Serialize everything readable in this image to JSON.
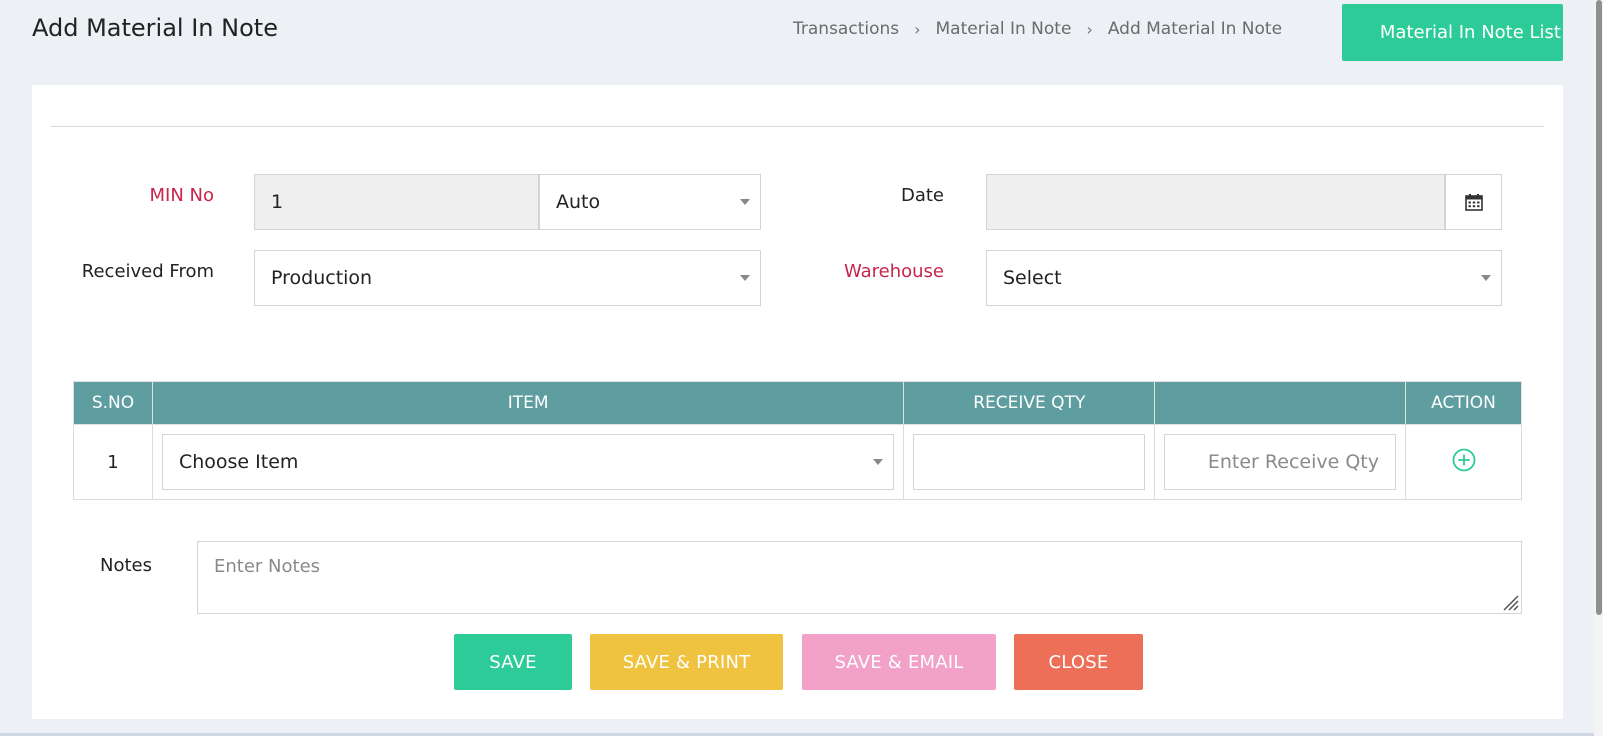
{
  "page": {
    "title": "Add Material In Note",
    "breadcrumb": [
      "Transactions",
      "Material In Note",
      "Add Material In Note"
    ],
    "list_button": "Material In Note List"
  },
  "form": {
    "min_no": {
      "label": "MIN No",
      "value": "1",
      "mode": "Auto"
    },
    "date": {
      "label": "Date",
      "value": ""
    },
    "received_from": {
      "label": "Received From",
      "value": "Production"
    },
    "warehouse": {
      "label": "Warehouse",
      "value": "Select"
    }
  },
  "table": {
    "headers": [
      "S.NO",
      "ITEM",
      "RECEIVE QTY",
      "",
      "ACTION"
    ],
    "rows": [
      {
        "sno": "1",
        "item": "Choose Item",
        "qty": "",
        "receive_placeholder": "Enter Receive Qty"
      }
    ]
  },
  "notes": {
    "label": "Notes",
    "placeholder": "Enter Notes"
  },
  "buttons": {
    "save": "SAVE",
    "save_print": "SAVE & PRINT",
    "save_email": "SAVE & EMAIL",
    "close": "CLOSE"
  },
  "colors": {
    "primary": "#2dcb98",
    "table_header": "#5f9ea0",
    "required_label": "#c8244c",
    "save_print": "#efc33f",
    "save_email": "#f2a2c8",
    "close": "#ee6f57"
  },
  "icons": [
    "chevron-right-icon",
    "calendar-icon",
    "caret-down-icon",
    "add-circle-icon",
    "resize-handle-icon"
  ]
}
